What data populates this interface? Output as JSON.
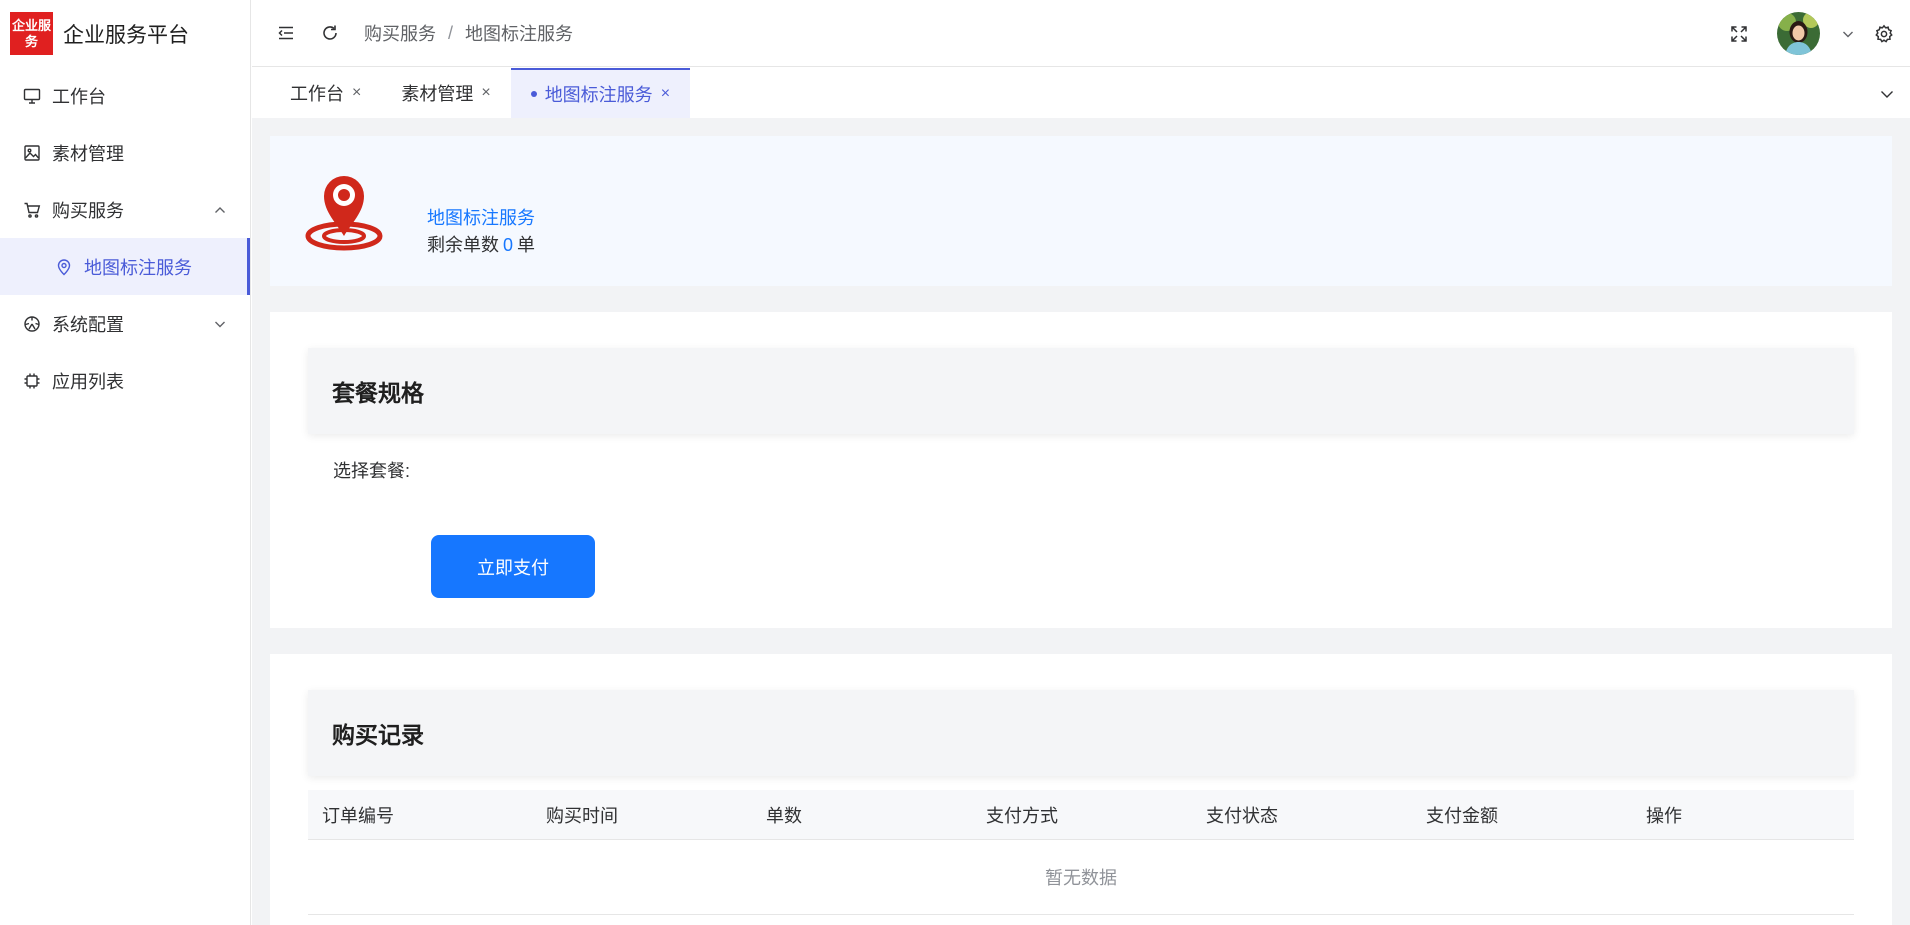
{
  "brand": {
    "logo_text": "企业服务",
    "title": "企业服务平台",
    "brand_color": "#e02020"
  },
  "sidebar": {
    "items": [
      {
        "label": "工作台",
        "icon": "monitor-icon"
      },
      {
        "label": "素材管理",
        "icon": "image-icon"
      },
      {
        "label": "购买服务",
        "icon": "cart-icon",
        "expanded": true
      },
      {
        "label": "地图标注服务",
        "icon": "location-icon",
        "active": true
      },
      {
        "label": "系统配置",
        "icon": "dashboard-icon",
        "expanded": false
      },
      {
        "label": "应用列表",
        "icon": "chip-icon"
      }
    ]
  },
  "header": {
    "breadcrumb": [
      "购买服务",
      "地图标注服务"
    ],
    "breadcrumb_sep": "/"
  },
  "tabs": [
    {
      "label": "工作台",
      "close": "×"
    },
    {
      "label": "素材管理",
      "close": "×"
    },
    {
      "label": "地图标注服务",
      "close": "×",
      "active": true
    }
  ],
  "service": {
    "name": "地图标注服务",
    "remain_prefix": "剩余单数",
    "remain_count": "0",
    "remain_unit": "单"
  },
  "package": {
    "title": "套餐规格",
    "select_label": "选择套餐:",
    "pay_button": "立即支付"
  },
  "records": {
    "title": "购买记录",
    "columns": [
      "订单编号",
      "购买时间",
      "单数",
      "支付方式",
      "支付状态",
      "支付金额",
      "操作"
    ],
    "empty_text": "暂无数据"
  },
  "colors": {
    "accent": "#4a5bd8",
    "primary": "#1677ff",
    "pin": "#d0281b"
  }
}
